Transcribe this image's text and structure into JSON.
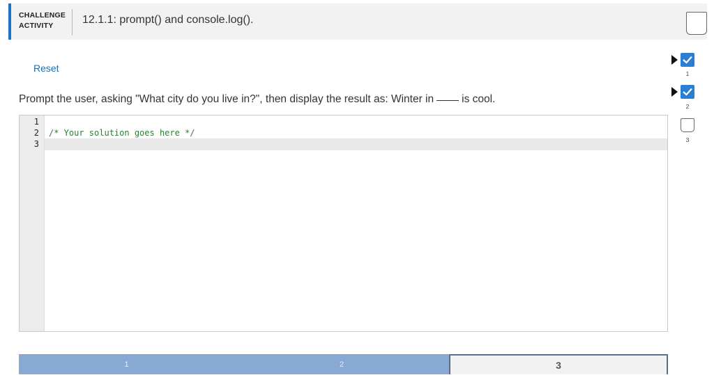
{
  "header": {
    "badge_line1": "CHALLENGE",
    "badge_line2": "ACTIVITY",
    "title": "12.1.1: prompt() and console.log()."
  },
  "reset_label": "Reset",
  "instructions": {
    "before": "Prompt the user, asking \"What city do you live in?\", then display the result as: Winter in",
    "after": "is cool."
  },
  "editor": {
    "line_numbers": [
      "1",
      "2",
      "3"
    ],
    "lines": [
      "",
      "/* Your solution goes here */",
      ""
    ]
  },
  "steps": [
    {
      "label": "1",
      "state": "done"
    },
    {
      "label": "2",
      "state": "done"
    },
    {
      "label": "3",
      "state": "current"
    }
  ],
  "levels": [
    {
      "label": "1",
      "state": "done"
    },
    {
      "label": "2",
      "state": "done"
    },
    {
      "label": "3",
      "state": "todo"
    }
  ],
  "colors": {
    "accent": "#1a73c8",
    "link": "#1b6fb3",
    "done_step": "#88a9d4",
    "level_done": "#2a7fd4",
    "code_comment": "#2e7d32"
  }
}
